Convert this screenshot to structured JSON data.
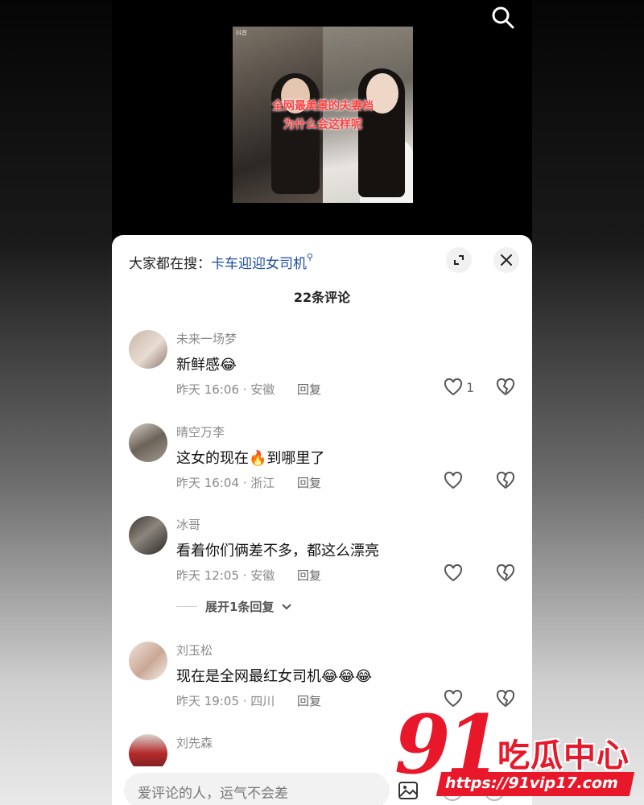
{
  "video": {
    "thumbnail_caption_line1": "全网最美景的夫妻档",
    "thumbnail_caption_line2": "为什么会这样呢",
    "thumbnail_watermark": "抖音"
  },
  "hot_search": {
    "prefix": "大家都在搜：",
    "keyword": "卡车迎迎女司机"
  },
  "comment_count": "22条评论",
  "comments": [
    {
      "username": "未来一场梦",
      "text": "新鲜感😂",
      "time_location": "昨天 16:06 · 安徽",
      "reply_label": "回复",
      "like_count": "1"
    },
    {
      "username": "晴空万李",
      "text": "这女的现在🔥到哪里了",
      "time_location": "昨天 16:04 · 浙江",
      "reply_label": "回复",
      "like_count": ""
    },
    {
      "username": "冰哥",
      "text": "看着你们俩差不多，都这么漂亮",
      "time_location": "昨天 12:05 · 安徽",
      "reply_label": "回复",
      "like_count": "",
      "expand_replies": "展开1条回复"
    },
    {
      "username": "刘玉松",
      "text": "现在是全网最红女司机😂😂😂",
      "time_location": "昨天 19:05 · 四川",
      "reply_label": "回复",
      "like_count": ""
    },
    {
      "username": "刘先森",
      "text": "",
      "time_location": "",
      "reply_label": "",
      "like_count": ""
    }
  ],
  "input": {
    "placeholder": "爱评论的人，运气不会差"
  },
  "watermark": {
    "logo_number": "91",
    "logo_text": "吃瓜中心",
    "url": "https://91vip17.com"
  },
  "colors": {
    "link": "#1e4ea0",
    "watermark_red": "#e8182a"
  }
}
